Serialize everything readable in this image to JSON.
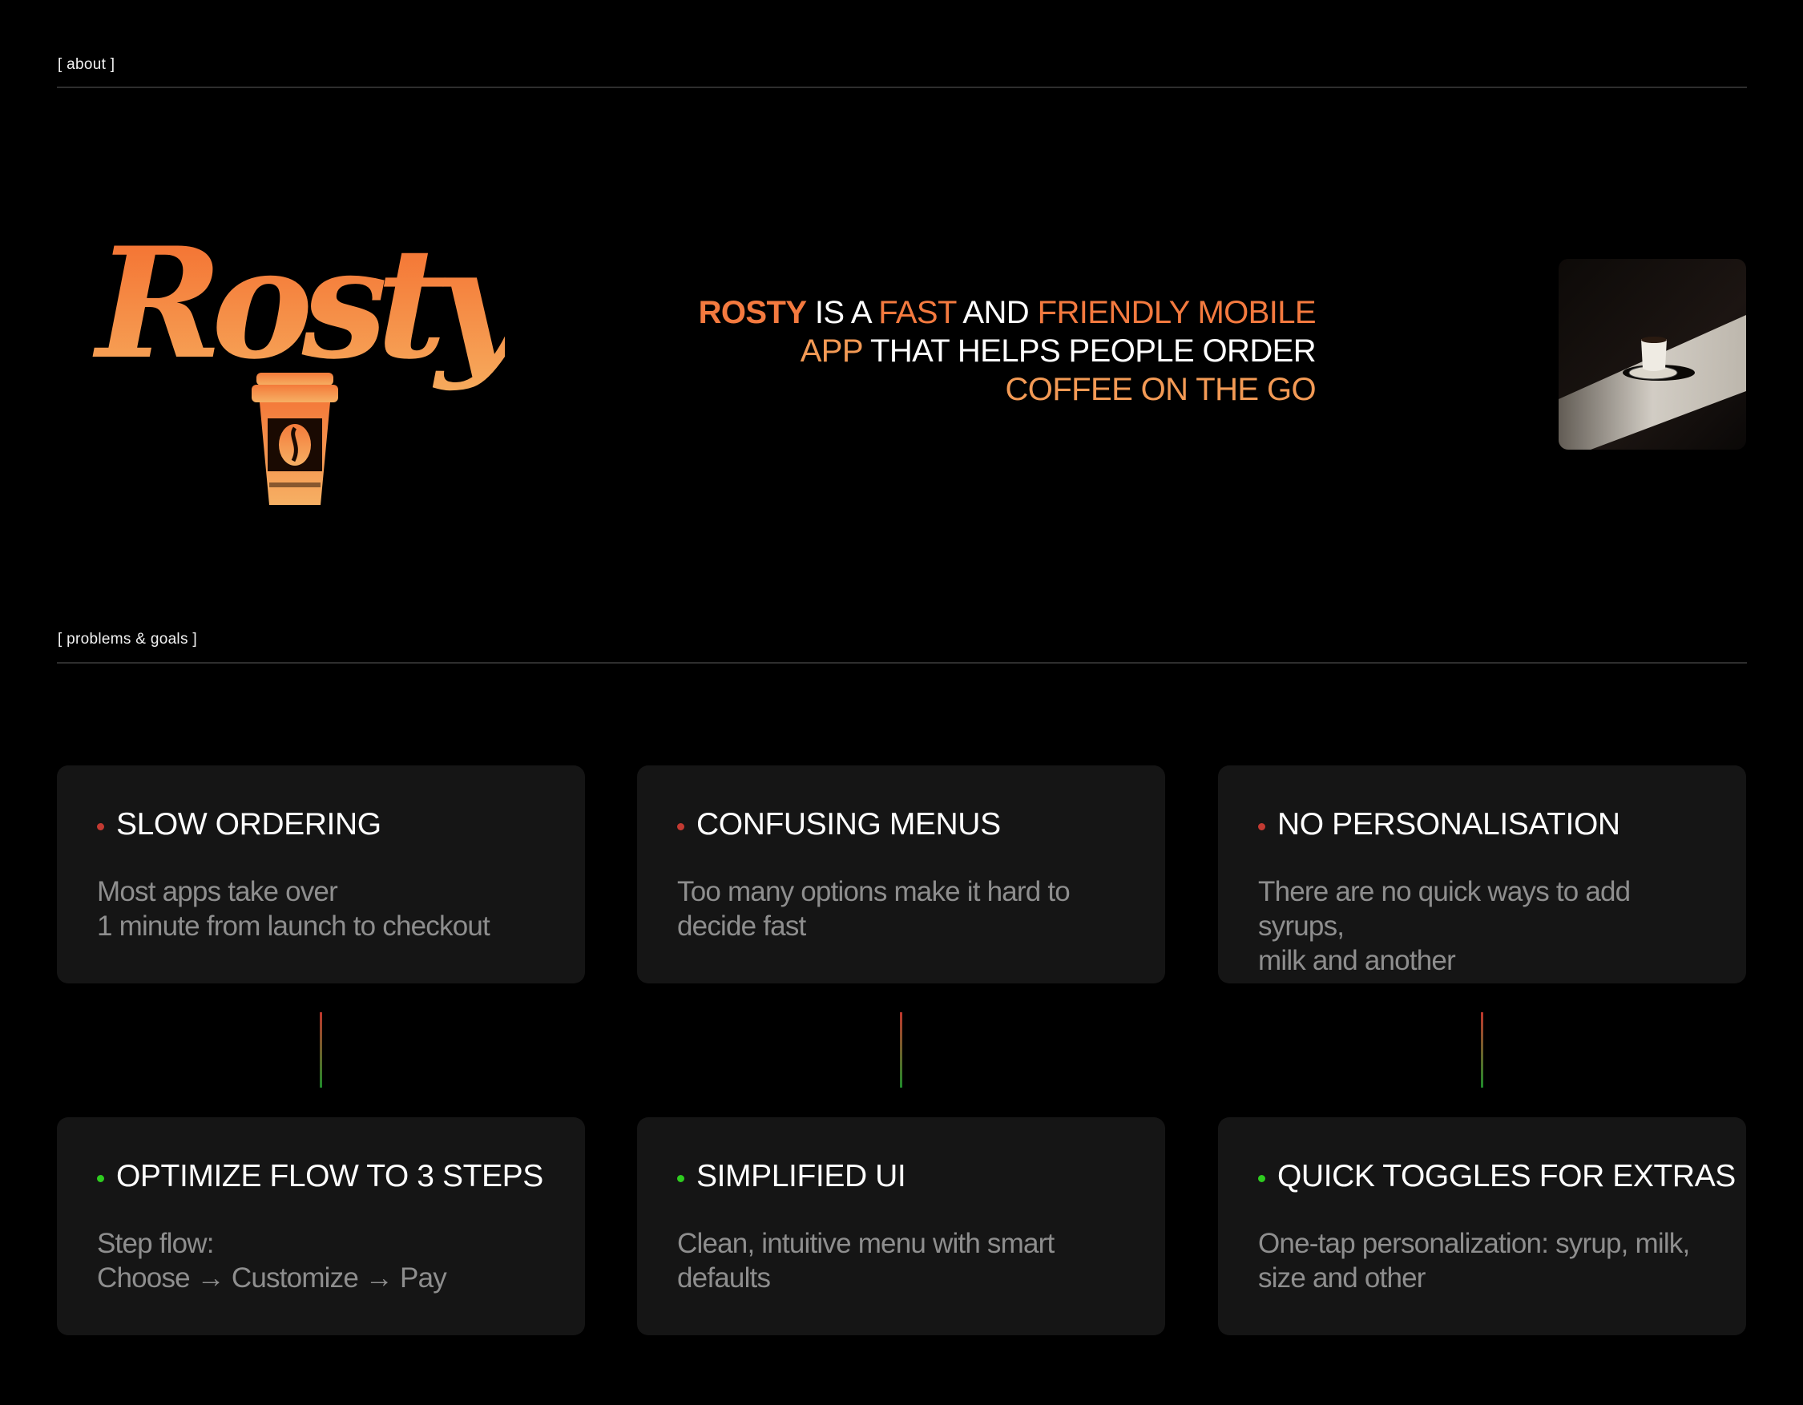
{
  "about": {
    "label": "[ about ]"
  },
  "tagline": {
    "brand": "ROSTY",
    "p1": " IS A ",
    "fast": "FAST",
    "p2": " AND ",
    "friendly": "FRIENDLY MOBILE",
    "app": "APP",
    "p3": " THAT HELPS PEOPLE ORDER",
    "coffee": "COFFEE ON THE GO"
  },
  "logo": {
    "text": "Rosty"
  },
  "problems_goals": {
    "label": "[ problems & goals ]"
  },
  "colors": {
    "accent": "#f47a3f",
    "problem_dot": "#c23a32",
    "goal_dot": "#2ecc1f",
    "card_bg": "#151515"
  },
  "problems": [
    {
      "title": "SLOW ORDERING",
      "line1": "Most apps take over",
      "line2": "1 minute from launch to checkout"
    },
    {
      "title": "CONFUSING MENUS",
      "line1": "Too many options make it hard to",
      "line2": "decide fast"
    },
    {
      "title": "NO PERSONALISATION",
      "line1": "There are no quick ways to add syrups,",
      "line2": "milk and another"
    }
  ],
  "goals": [
    {
      "title": "OPTIMIZE FLOW TO 3 STEPS",
      "line1": "Step flow:",
      "line2": "Choose → Customize → Pay"
    },
    {
      "title": "SIMPLIFIED UI",
      "line1": "Clean, intuitive menu with smart",
      "line2": "defaults"
    },
    {
      "title": "QUICK TOGGLES FOR EXTRAS",
      "line1": "One-tap personalization: syrup, milk,",
      "line2": "size and other"
    }
  ]
}
